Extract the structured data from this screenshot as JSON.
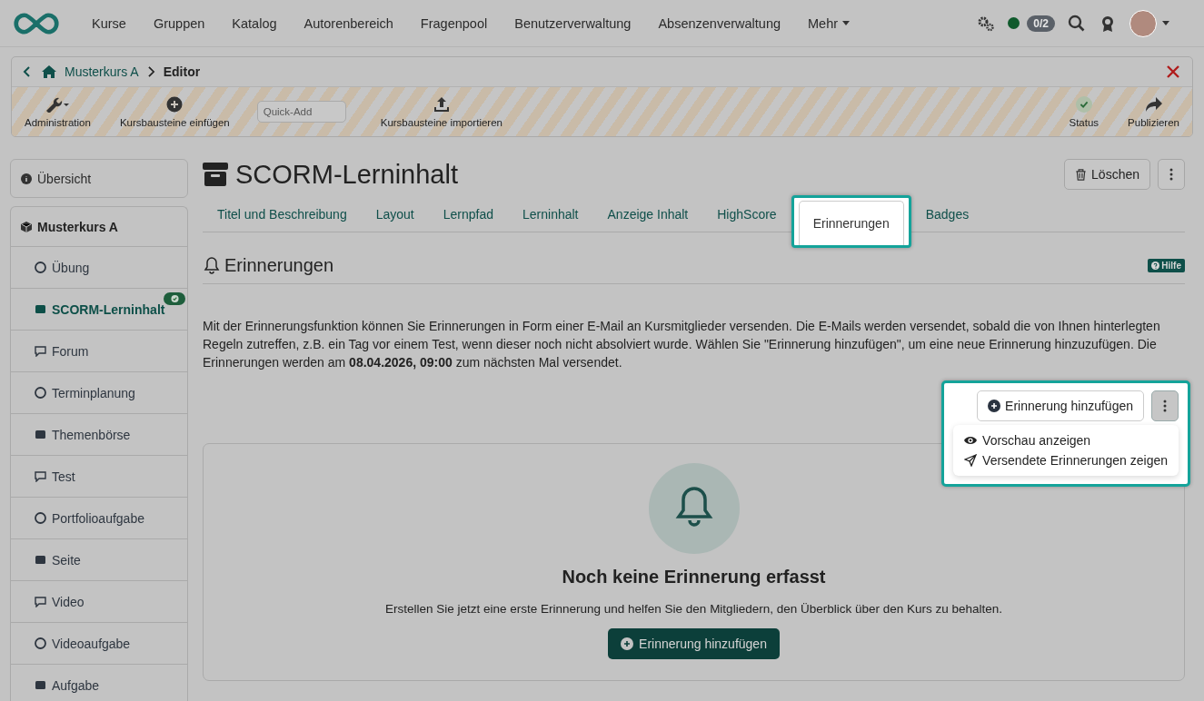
{
  "topnav": {
    "items": [
      {
        "label": "Kurse",
        "dropdown": false
      },
      {
        "label": "Gruppen",
        "dropdown": false
      },
      {
        "label": "Katalog",
        "dropdown": false
      },
      {
        "label": "Autorenbereich",
        "dropdown": false
      },
      {
        "label": "Fragenpool",
        "dropdown": false
      },
      {
        "label": "Benutzerverwaltung",
        "dropdown": false
      },
      {
        "label": "Absenzenverwaltung",
        "dropdown": false
      },
      {
        "label": "Mehr",
        "dropdown": true
      }
    ],
    "online": true,
    "counter": "0/2"
  },
  "editor": {
    "breadcrumb": [
      "Musterkurs A",
      "Editor"
    ],
    "tools": [
      {
        "kind": "wrench",
        "label": "Administration"
      },
      {
        "kind": "add",
        "label": "Kursbausteine einfügen"
      },
      {
        "kind": "input",
        "placeholder": "Quick-Add"
      },
      {
        "kind": "upload",
        "label": "Kursbausteine importieren"
      }
    ],
    "right_tools": [
      {
        "kind": "status",
        "label": "Status"
      },
      {
        "kind": "publish",
        "label": "Publizieren"
      }
    ]
  },
  "sidebar": {
    "overview": "Übersicht",
    "course": "Musterkurs A",
    "items": [
      {
        "label": "Übung",
        "selected": false,
        "done": false
      },
      {
        "label": "SCORM-Lerninhalt",
        "selected": true,
        "done": true
      },
      {
        "label": "Forum",
        "selected": false,
        "done": false
      },
      {
        "label": "Terminplanung",
        "selected": false,
        "done": false
      },
      {
        "label": "Themenbörse",
        "selected": false,
        "done": false
      },
      {
        "label": "Test",
        "selected": false,
        "done": false
      },
      {
        "label": "Portfolioaufgabe",
        "selected": false,
        "done": false
      },
      {
        "label": "Seite",
        "selected": false,
        "done": false
      },
      {
        "label": "Video",
        "selected": false,
        "done": false
      },
      {
        "label": "Videoaufgabe",
        "selected": false,
        "done": false
      },
      {
        "label": "Aufgabe",
        "selected": false,
        "done": false
      }
    ]
  },
  "page": {
    "title": "SCORM-Lerninhalt",
    "delete_button": "Löschen",
    "tabs": [
      {
        "label": "Titel und Beschreibung",
        "selected": false
      },
      {
        "label": "Layout",
        "selected": false
      },
      {
        "label": "Lernpfad",
        "selected": false
      },
      {
        "label": "Lerninhalt",
        "selected": false
      },
      {
        "label": "Anzeige Inhalt",
        "selected": false
      },
      {
        "label": "HighScore",
        "selected": false
      },
      {
        "label": "Erinnerungen",
        "selected": true
      },
      {
        "label": "Badges",
        "selected": false
      }
    ],
    "section_title": "Erinnerungen",
    "help": "Hilfe",
    "description": "Mit der Erinnerungsfunktion können Sie Erinnerungen in Form einer E-Mail an Kursmitglieder versenden. Die E-Mails werden versendet, sobald die von Ihnen hinterlegten Regeln zutreffen, z.B. ein Tag vor einem Test, wenn dieser noch nicht absolviert wurde. Wählen Sie \"Erinnerung hinzufügen\", um eine neue Erinnerung hinzuzufügen. Die Erinnerungen werden am **08.04.2026, 09:00** zum nächsten Mal versendet.",
    "actions": {
      "highlighted": true,
      "add_button": "Erinnerung hinzufügen",
      "menu_open": true,
      "menu": [
        {
          "kind": "eye",
          "label": "Vorschau anzeigen"
        },
        {
          "kind": "send",
          "label": "Versendete Erinnerungen zeigen"
        }
      ]
    },
    "empty": {
      "title": "Noch keine Erinnerung erfasst",
      "text": "Erstellen Sie jetzt eine erste Erinnerung und helfen Sie den Mitgliedern, den Überblick über den Kurs zu behalten.",
      "button": "Erinnerung hinzufügen"
    }
  }
}
